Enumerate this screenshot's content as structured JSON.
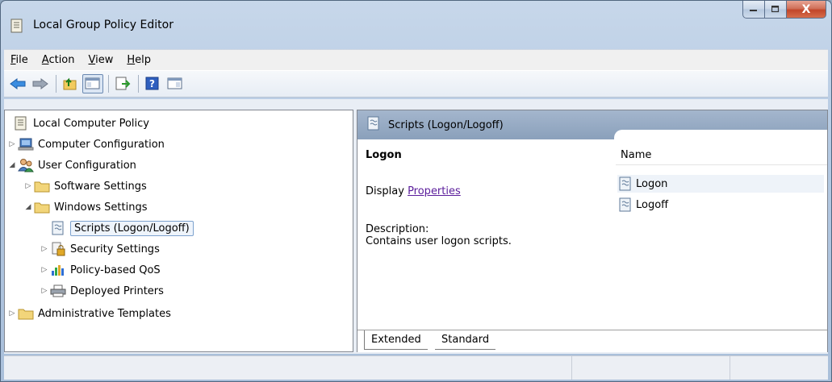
{
  "window": {
    "title": "Local Group Policy Editor",
    "caption_close": "X"
  },
  "menu": [
    {
      "pre": "",
      "key": "F",
      "post": "ile"
    },
    {
      "pre": "",
      "key": "A",
      "post": "ction"
    },
    {
      "pre": "",
      "key": "V",
      "post": "iew"
    },
    {
      "pre": "",
      "key": "H",
      "post": "elp"
    }
  ],
  "toolbar": {
    "buttons": [
      "back-arrow-icon",
      "forward-arrow-icon",
      "up-folder-icon",
      "show-hide-tree-icon",
      "export-list-icon",
      "help-icon",
      "properties-icon"
    ]
  },
  "tree": {
    "root": "Local Computer Policy",
    "computer_configuration": "Computer Configuration",
    "user_configuration": "User Configuration",
    "software_settings": "Software Settings",
    "windows_settings": "Windows Settings",
    "scripts": "Scripts (Logon/Logoff)",
    "security_settings": "Security Settings",
    "policy_qos": "Policy-based QoS",
    "deployed_printers": "Deployed Printers",
    "administrative_templates": "Administrative Templates"
  },
  "details": {
    "header": "Scripts (Logon/Logoff)",
    "title": "Logon",
    "display_label": "Display",
    "properties_link": "Properties",
    "description_label": "Description:",
    "description_text": "Contains user logon scripts.",
    "list_column_name": "Name",
    "items": [
      "Logon",
      "Logoff"
    ],
    "tabs": [
      "Extended",
      "Standard"
    ]
  },
  "colors": {
    "header_bg": "#8aa0bb",
    "link": "#5a1c9b",
    "selection_border": "#7da2ce"
  }
}
